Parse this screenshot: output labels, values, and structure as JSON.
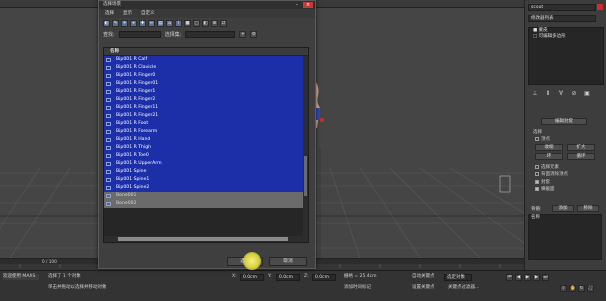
{
  "dialog": {
    "title": "选择场景",
    "menu": [
      "选择",
      "显示",
      "自定义"
    ],
    "find_label": "查找:",
    "selection_set_label": "选择集:",
    "column_header": "名称",
    "items": [
      {
        "label": "Bip001 R Calf",
        "selected": true
      },
      {
        "label": "Bip001 R Clavicle",
        "selected": true
      },
      {
        "label": "Bip001 R Finger0",
        "selected": true
      },
      {
        "label": "Bip001 R Finger01",
        "selected": true
      },
      {
        "label": "Bip001 R Finger1",
        "selected": true
      },
      {
        "label": "Bip001 R Finger2",
        "selected": true
      },
      {
        "label": "Bip001 R Finger11",
        "selected": true
      },
      {
        "label": "Bip001 R Finger21",
        "selected": true
      },
      {
        "label": "Bip001 R Foot",
        "selected": true
      },
      {
        "label": "Bip001 R Forearm",
        "selected": true
      },
      {
        "label": "Bip001 R Hand",
        "selected": true
      },
      {
        "label": "Bip001 R Thigh",
        "selected": true
      },
      {
        "label": "Bip001 R Toe0",
        "selected": true
      },
      {
        "label": "Bip001 R UpperArm",
        "selected": true
      },
      {
        "label": "Bip001 Spine",
        "selected": true
      },
      {
        "label": "Bip001 Spine1",
        "selected": true
      },
      {
        "label": "Bip001 Spine2",
        "selected": true
      },
      {
        "label": "Bone001",
        "selected": false
      },
      {
        "label": "Bone002",
        "selected": false
      }
    ],
    "cancel_label": "取消",
    "ok_label": "选择"
  },
  "command_panel": {
    "object_name": "scout",
    "modifier_list_label": "修改器列表",
    "stack": [
      "■ 蒙皮",
      "□ 可编辑多边形"
    ],
    "edit_envelope_label": "编辑封套",
    "select_label": "选择",
    "vertex_label": "顶点",
    "shrink_label": "收缩",
    "grow_label": "扩大",
    "ring_label": "环",
    "loop_label": "循环",
    "select_element_label": "选择元素",
    "backface_label": "背面消除顶点",
    "envelope_label": "封套",
    "cross_section_label": "横截面",
    "bones_label": "骨骼:",
    "add_label": "添加",
    "remove_label": "移除",
    "name_label": "名称"
  },
  "timeline": {
    "frame_label": "0 / 100"
  },
  "status": {
    "welcome_label": "欢迎使用 MAXS",
    "selected_label": "选择了 1 个对象",
    "hint_label": "单击并拖动以选择并移动对象",
    "x_label": "X:",
    "x_value": "0.0cm",
    "y_label": "Y:",
    "y_value": "0.0cm",
    "z_label": "Z:",
    "z_value": "0.0cm",
    "grid_label": "栅格 = 25.4cm",
    "add_time_tag": "添加时间标记",
    "auto_key_label": "自动关键点",
    "selected_obj_label": "选定对象",
    "set_key_label": "设置关键点",
    "key_filter_label": "关键点过滤器..."
  },
  "colors": {
    "selection": "#1c2fa8",
    "unselected_row": "#6b6b6b",
    "close": "#c23b3b",
    "object_color": "#d42a2a"
  }
}
